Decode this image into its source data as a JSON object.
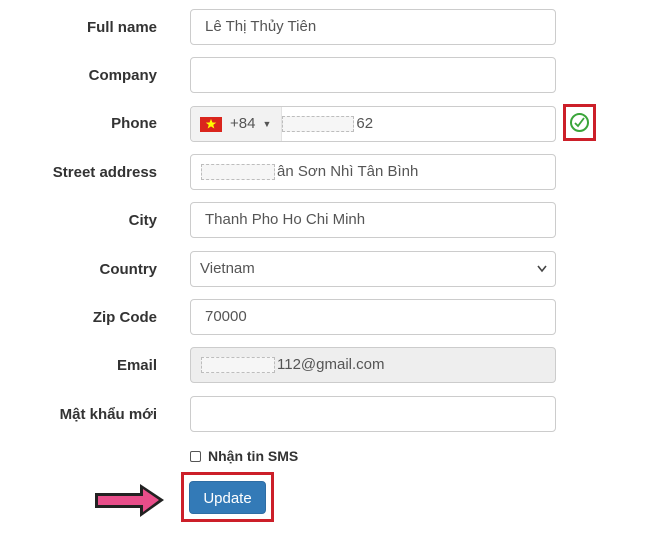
{
  "form": {
    "full_name": {
      "label": "Full name",
      "value": "Lê Thị Thủy Tiên"
    },
    "company": {
      "label": "Company",
      "value": ""
    },
    "phone": {
      "label": "Phone",
      "dial_code": "+84",
      "value_suffix": "62",
      "flag": "vietnam-flag-icon"
    },
    "street": {
      "label": "Street address",
      "value_suffix": "ân Sơn Nhì Tân Bình"
    },
    "city": {
      "label": "City",
      "value": "Thanh Pho Ho Chi Minh"
    },
    "country": {
      "label": "Country",
      "selected": "Vietnam"
    },
    "zip": {
      "label": "Zip Code",
      "value": "70000"
    },
    "email": {
      "label": "Email",
      "value_suffix": "112@gmail.com"
    },
    "new_password": {
      "label": "Mật khẩu mới",
      "value": ""
    },
    "sms": {
      "label": "Nhận tin SMS",
      "checked": false
    },
    "update_label": "Update"
  },
  "colors": {
    "primary": "#337ab7",
    "highlight": "#cc1f29",
    "valid": "#3aa53a",
    "arrow": "#e84e8a"
  }
}
